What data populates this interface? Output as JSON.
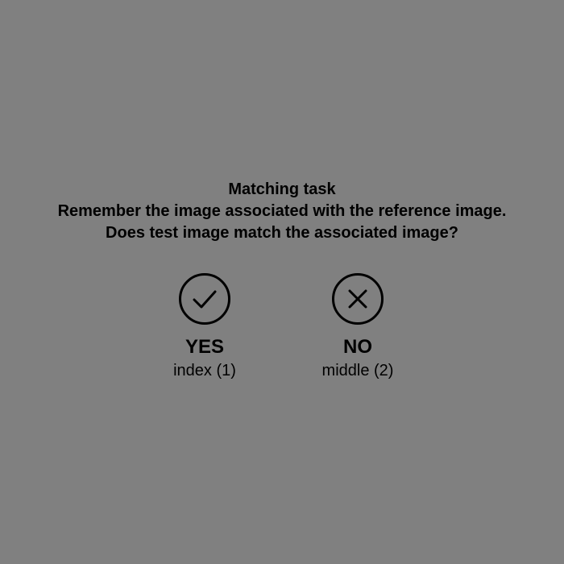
{
  "instructions": {
    "title": "Matching task",
    "line1": "Remember the image associated with the reference image.",
    "line2": "Does test image match the associated image?"
  },
  "options": {
    "yes": {
      "icon": "check-circle-icon",
      "label": "YES",
      "key_hint": "index (1)"
    },
    "no": {
      "icon": "x-circle-icon",
      "label": "NO",
      "key_hint": "middle (2)"
    }
  },
  "colors": {
    "background": "#808080",
    "foreground": "#000000"
  }
}
